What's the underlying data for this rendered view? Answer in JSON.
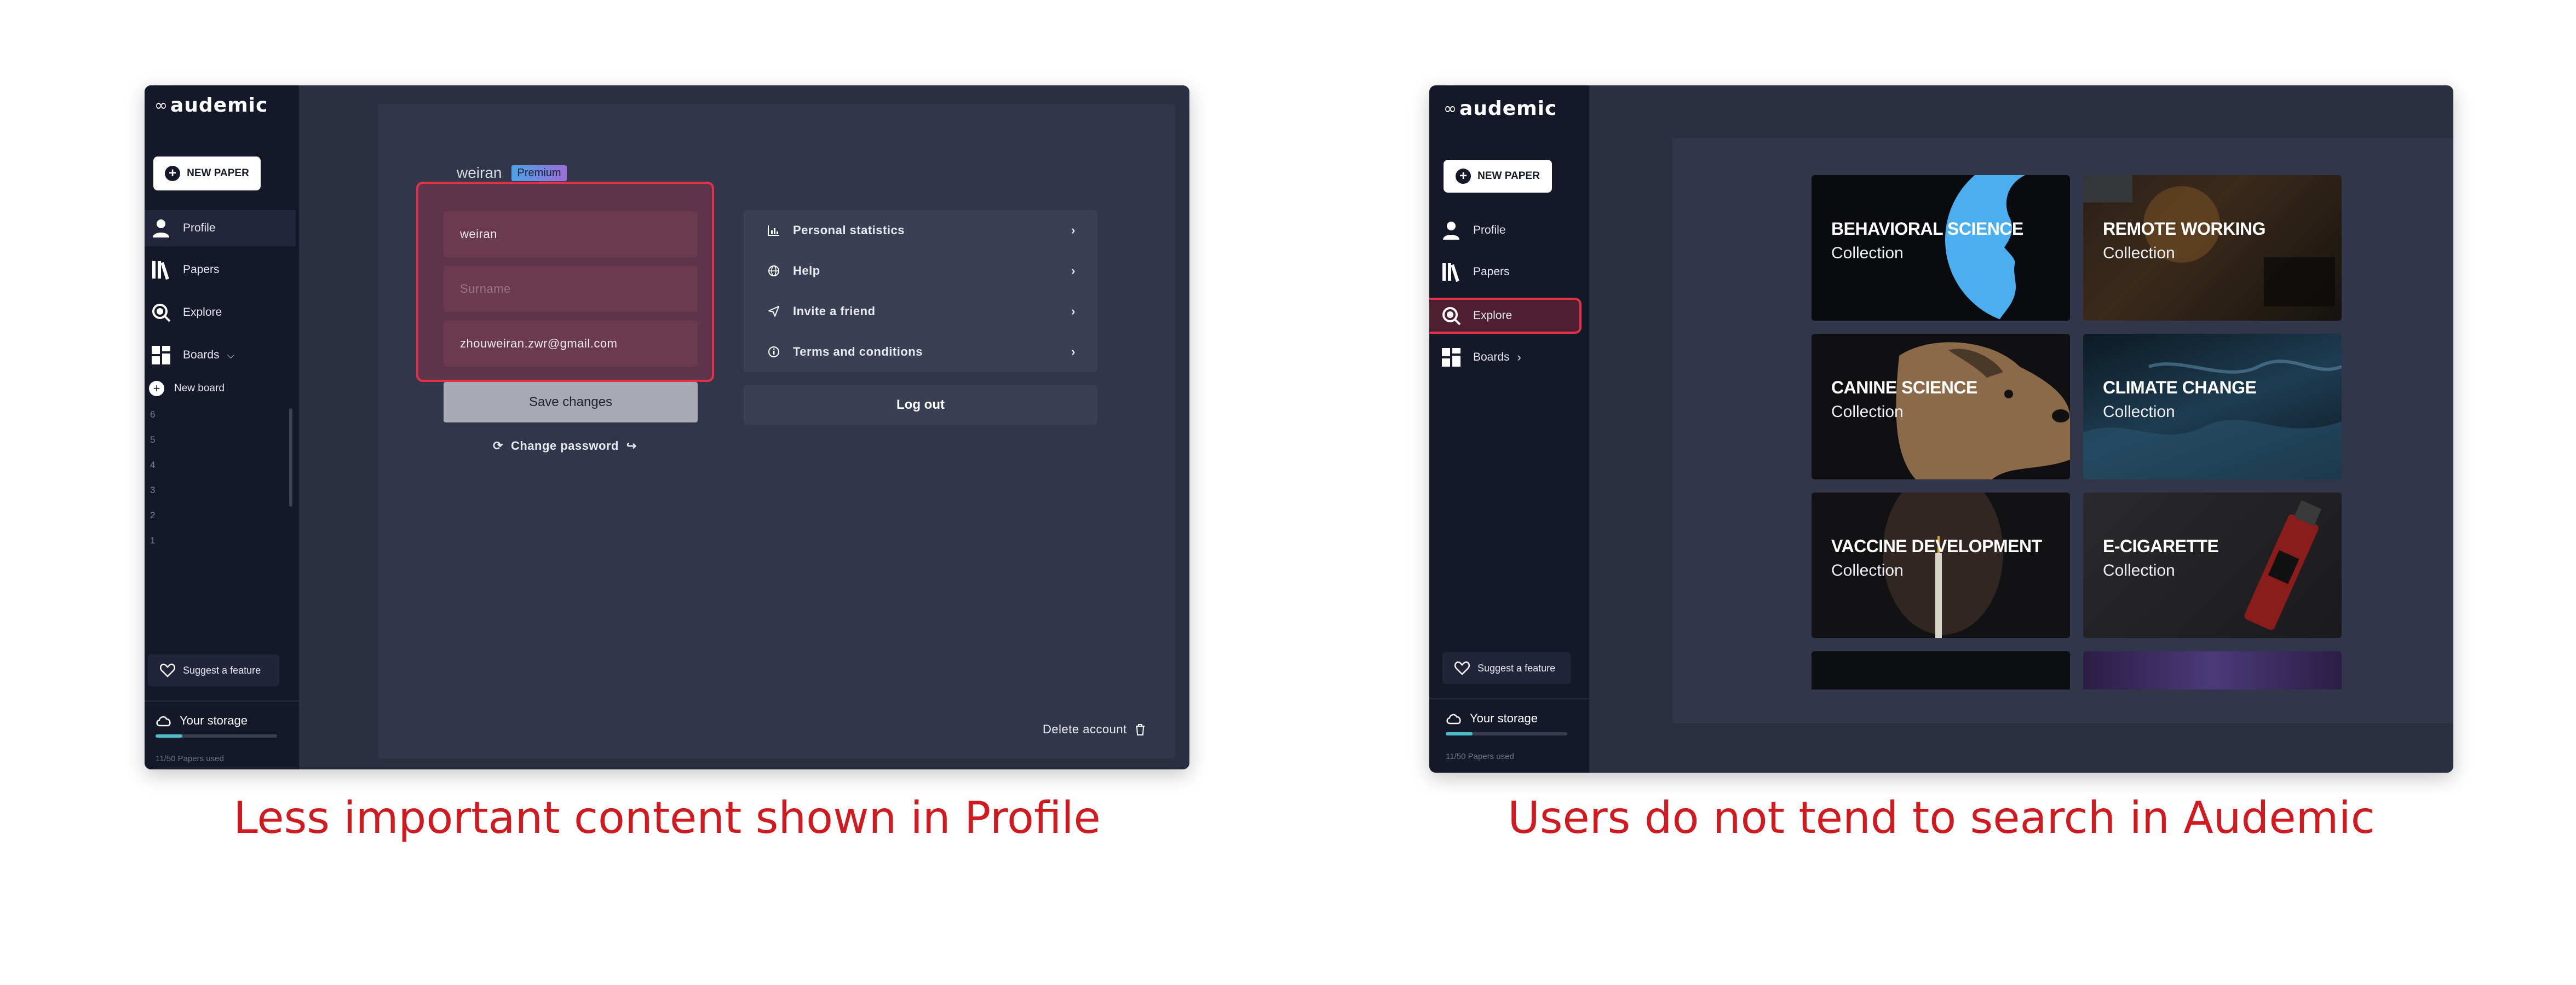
{
  "left": {
    "logo": "audemic",
    "new_paper": "NEW PAPER",
    "nav": [
      {
        "label": "Profile",
        "icon": "person-icon"
      },
      {
        "label": "Papers",
        "icon": "books-icon"
      },
      {
        "label": "Explore",
        "icon": "explore-icon"
      },
      {
        "label": "Boards",
        "icon": "boards-icon"
      }
    ],
    "new_board": "New board",
    "board_numbers": [
      "6",
      "5",
      "4",
      "3",
      "2",
      "1"
    ],
    "suggest": "Suggest a feature",
    "storage_title": "Your storage",
    "storage_caption": "11/50 Papers used",
    "storage_used_fraction": 0.22,
    "profile_name": "weiran",
    "badge": "Premium",
    "fields": {
      "first_name": "weiran",
      "surname_placeholder": "Surname",
      "email": "zhouweiran.zwr@gmail.com"
    },
    "save_label": "Save changes",
    "change_password": "Change password",
    "menu": [
      {
        "label": "Personal statistics",
        "icon": "bar-chart-icon"
      },
      {
        "label": "Help",
        "icon": "globe-icon"
      },
      {
        "label": "Invite a friend",
        "icon": "send-icon"
      },
      {
        "label": "Terms and conditions",
        "icon": "info-icon"
      }
    ],
    "logout": "Log out",
    "delete_account": "Delete account",
    "caption": "Less important content shown in Profile"
  },
  "right": {
    "logo": "audemic",
    "new_paper": "NEW PAPER",
    "nav": [
      {
        "label": "Profile",
        "icon": "person-icon"
      },
      {
        "label": "Papers",
        "icon": "books-icon"
      },
      {
        "label": "Explore",
        "icon": "explore-icon"
      },
      {
        "label": "Boards",
        "icon": "boards-icon"
      }
    ],
    "suggest": "Suggest a feature",
    "storage_title": "Your storage",
    "storage_caption": "11/50 Papers used",
    "storage_used_fraction": 0.22,
    "collections": [
      {
        "title": "BEHAVIORAL SCIENCE",
        "subtitle": "Collection"
      },
      {
        "title": "REMOTE WORKING",
        "subtitle": "Collection"
      },
      {
        "title": "CANINE SCIENCE",
        "subtitle": "Collection"
      },
      {
        "title": "CLIMATE CHANGE",
        "subtitle": "Collection"
      },
      {
        "title": "VACCINE DEVELOPMENT",
        "subtitle": "Collection"
      },
      {
        "title": "E-CIGARETTE",
        "subtitle": "Collection"
      }
    ],
    "caption": "Users do not tend to search in Audemic"
  },
  "colors": {
    "highlight": "#e3314a",
    "caption": "#cf1a1f",
    "sidebar": "#151828",
    "panel": "#2b2f42"
  }
}
